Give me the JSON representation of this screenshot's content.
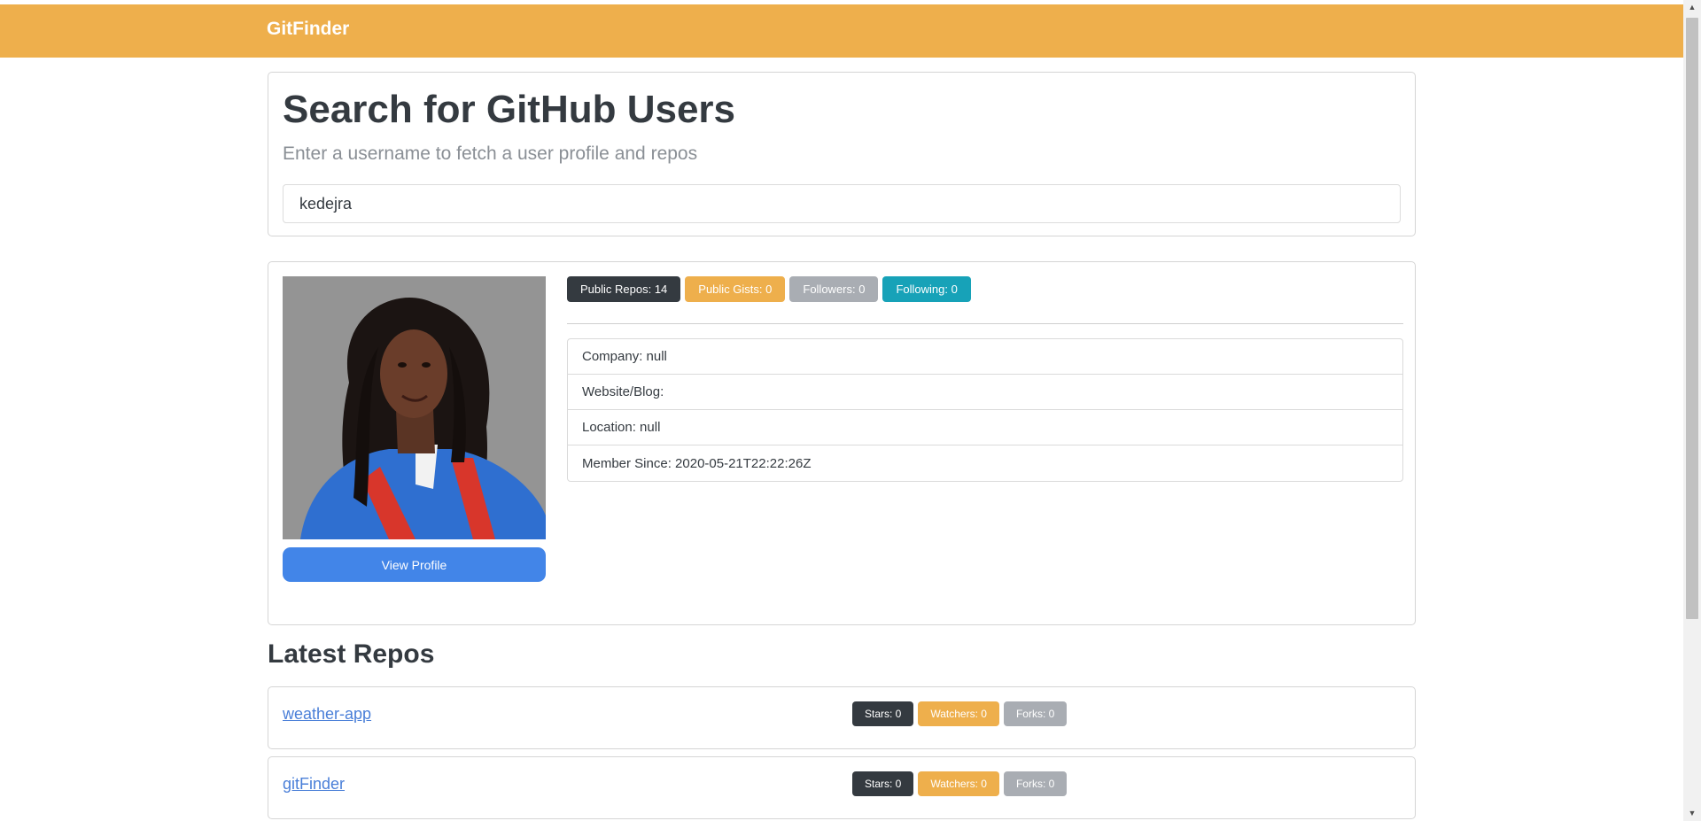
{
  "navbar": {
    "brand": "GitFinder"
  },
  "search": {
    "title": "Search for GitHub Users",
    "lead": "Enter a username to fetch a user profile and repos",
    "value": "kedejra"
  },
  "profile": {
    "view_profile_label": "View Profile",
    "badges": {
      "public_repos": "Public Repos: 14",
      "public_gists": "Public Gists: 0",
      "followers": "Followers: 0",
      "following": "Following: 0"
    },
    "info": {
      "company": "Company: null",
      "website": "Website/Blog:",
      "location": "Location: null",
      "member_since": "Member Since: 2020-05-21T22:22:26Z"
    }
  },
  "repos": {
    "title": "Latest Repos",
    "items": [
      {
        "name": "weather-app",
        "stars": "Stars: 0",
        "watchers": "Watchers: 0",
        "forks": "Forks: 0"
      },
      {
        "name": "gitFinder",
        "stars": "Stars: 0",
        "watchers": "Watchers: 0",
        "forks": "Forks: 0"
      }
    ]
  },
  "colors": {
    "navbar": "#eeaf4c",
    "dark_badge": "#343a40",
    "orange_badge": "#eeaf4c",
    "gray_badge": "#a9adb3",
    "teal_badge": "#17a2b8",
    "primary_button": "#4285e8",
    "link": "#4a7fd8"
  },
  "icons": {
    "scroll_up": "▲",
    "scroll_down": "▼"
  }
}
